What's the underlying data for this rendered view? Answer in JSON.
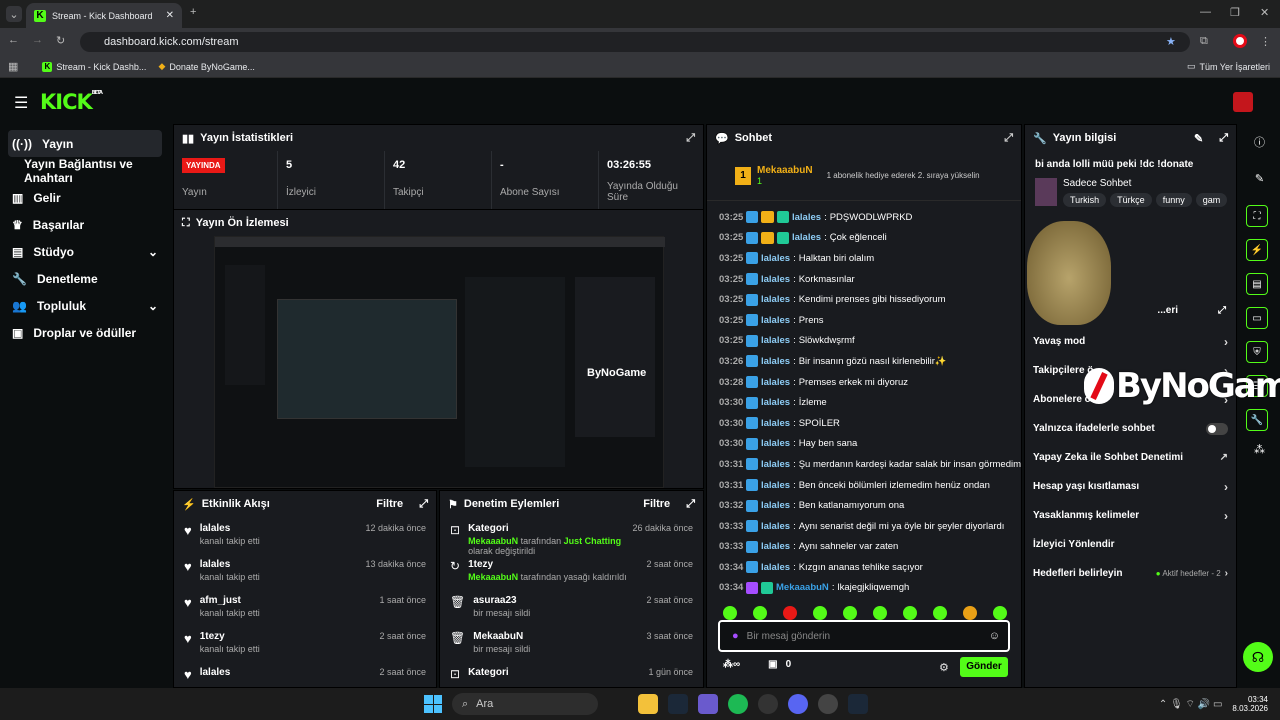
{
  "browser": {
    "tab_title": "Stream - Kick Dashboard",
    "url": "dashboard.kick.com/stream",
    "bookmarks": [
      "Stream - Kick Dashb...",
      "Donate ByNoGame..."
    ],
    "all_bookmarks": "Tüm Yer İşaretleri"
  },
  "logo": "KICK",
  "logo_sup": "BETA",
  "sidebar": {
    "items": [
      {
        "label": "Yayın"
      },
      {
        "label": "Yayın Bağlantısı ve Anahtarı"
      },
      {
        "label": "Gelir"
      },
      {
        "label": "Başarılar"
      },
      {
        "label": "Stüdyo"
      },
      {
        "label": "Denetleme"
      },
      {
        "label": "Topluluk"
      },
      {
        "label": "Droplar ve ödüller"
      }
    ]
  },
  "stats": {
    "title": "Yayın İstatistikleri",
    "live_badge": "YAYINDA",
    "live_label": "Yayın",
    "items": [
      {
        "value": "5",
        "label": "İzleyici"
      },
      {
        "value": "42",
        "label": "Takipçi"
      },
      {
        "value": "-",
        "label": "Abone Sayısı"
      },
      {
        "value": "03:26:55",
        "label": "Yayında Olduğu Süre"
      }
    ]
  },
  "preview": {
    "title": "Yayın Ön İzlemesi"
  },
  "activity": {
    "title": "Etkinlik Akışı",
    "filter": "Filtre",
    "items": [
      {
        "name": "lalales",
        "sub": "kanalı takip etti",
        "time": "12 dakika önce"
      },
      {
        "name": "lalales",
        "sub": "kanalı takip etti",
        "time": "13 dakika önce"
      },
      {
        "name": "afm_just",
        "sub": "kanalı takip etti",
        "time": "1 saat önce"
      },
      {
        "name": "1tezy",
        "sub": "kanalı takip etti",
        "time": "2 saat önce"
      },
      {
        "name": "lalales",
        "sub": "",
        "time": "2 saat önce"
      }
    ]
  },
  "moderation": {
    "title": "Denetim Eylemleri",
    "filter": "Filtre",
    "items": [
      {
        "name": "Kategori",
        "sub_user": "MekaaabuN",
        "sub": " tarafından ",
        "sub_hl": "Just Chatting",
        "sub2": " olarak değiştirildi",
        "time": "26 dakika önce"
      },
      {
        "name": "1tezy",
        "sub_user": "MekaaabuN",
        "sub": " tarafından yasağı kaldırıldı",
        "sub_hl": "",
        "sub2": "",
        "time": "2 saat önce"
      },
      {
        "name": "asuraa23",
        "sub_user": "",
        "sub": "bir mesajı sildi",
        "sub_hl": "",
        "sub2": "",
        "time": "2 saat önce"
      },
      {
        "name": "MekaabuN",
        "sub_user": "",
        "sub": "bir mesajı sildi",
        "sub_hl": "",
        "sub2": "",
        "time": "3 saat önce"
      },
      {
        "name": "Kategori",
        "sub_user": "",
        "sub": "",
        "sub_hl": "",
        "sub2": "",
        "time": "1 gün önce"
      }
    ]
  },
  "chat": {
    "title": "Sohbet",
    "pinned_user": "MekaaabuN",
    "pinned_count": "1",
    "pinned_text": "1 abonelik hediye ederek 2. sıraya yükselin",
    "messages": [
      {
        "time": "03:25",
        "user": "lalales",
        "text": "PDŞWODLWPRKD"
      },
      {
        "time": "03:25",
        "user": "lalales",
        "text": "Çok eğlenceli"
      },
      {
        "time": "03:25",
        "user": "lalales",
        "text": "Halktan biri olalım"
      },
      {
        "time": "03:25",
        "user": "lalales",
        "text": "Korkmasınlar"
      },
      {
        "time": "03:25",
        "user": "lalales",
        "text": "Kendimi prenses gibi hissediyorum"
      },
      {
        "time": "03:25",
        "user": "lalales",
        "text": "Prens"
      },
      {
        "time": "03:25",
        "user": "lalales",
        "text": "Slöwkdwşrmf"
      },
      {
        "time": "03:26",
        "user": "lalales",
        "text": "Bir insanın gözü nasıl kirlenebilir✨"
      },
      {
        "time": "03:28",
        "user": "lalales",
        "text": "Premses erkek mi diyoruz"
      },
      {
        "time": "03:30",
        "user": "lalales",
        "text": "İzleme"
      },
      {
        "time": "03:30",
        "user": "lalales",
        "text": "SPOİLER"
      },
      {
        "time": "03:30",
        "user": "lalales",
        "text": "Hay ben sana"
      },
      {
        "time": "03:31",
        "user": "lalales",
        "text": "Şu merdanın kardeşi kadar salak bir insan görmedim"
      },
      {
        "time": "03:31",
        "user": "lalales",
        "text": "Ben önceki bölümleri izlemedim henüz ondan"
      },
      {
        "time": "03:32",
        "user": "lalales",
        "text": "Ben katlanamıyorum ona"
      },
      {
        "time": "03:33",
        "user": "lalales",
        "text": "Aynı senarist değil mi ya öyle bir şeyler diyorlardı"
      },
      {
        "time": "03:33",
        "user": "lalales",
        "text": "Aynı sahneler var zaten"
      },
      {
        "time": "03:34",
        "user": "lalales",
        "text": "Kızgın ananas tehlike saçıyor"
      },
      {
        "time": "03:34",
        "user": "MekaaabuN",
        "text": "lkajegjkliqwemgh"
      }
    ],
    "input_placeholder": "Bir mesaj gönderin",
    "points": "0",
    "send": "Gönder"
  },
  "info": {
    "title": "Yayın bilgisi",
    "stream_title": "bi anda lolli müü peki !dc !donate",
    "category": "Sadece Sohbet",
    "tags": [
      "Turkish",
      "Türkçe",
      "funny",
      "gam"
    ],
    "settings_title": "...eri",
    "rows": [
      {
        "label": "Yavaş mod",
        "right": ""
      },
      {
        "label": "Takipçilere ö...",
        "right": ""
      },
      {
        "label": "Abonelere ö...",
        "right": ""
      },
      {
        "label": "Yalnızca ifadelerle sohbet",
        "right": "toggle"
      },
      {
        "label": "Yapay Zeka ile Sohbet Denetimi",
        "right": "ext"
      },
      {
        "label": "Hesap yaşı kısıtlaması",
        "right": ""
      },
      {
        "label": "Yasaklanmış kelimeler",
        "right": ""
      },
      {
        "label": "İzleyici Yönlendir",
        "right": "none"
      },
      {
        "label": "Hedefleri belirleyin",
        "right": "goal"
      }
    ],
    "goal_text": "Aktif hedefler - 2"
  },
  "overlay": {
    "brand": "ByNoGame"
  },
  "taskbar": {
    "search": "Ara",
    "time": "03:34",
    "date": "8.03.2026"
  },
  "colors": {
    "accent": "#53fc18",
    "live": "#e91916",
    "bg": "#0b0e0f",
    "panel": "#191b1f"
  }
}
